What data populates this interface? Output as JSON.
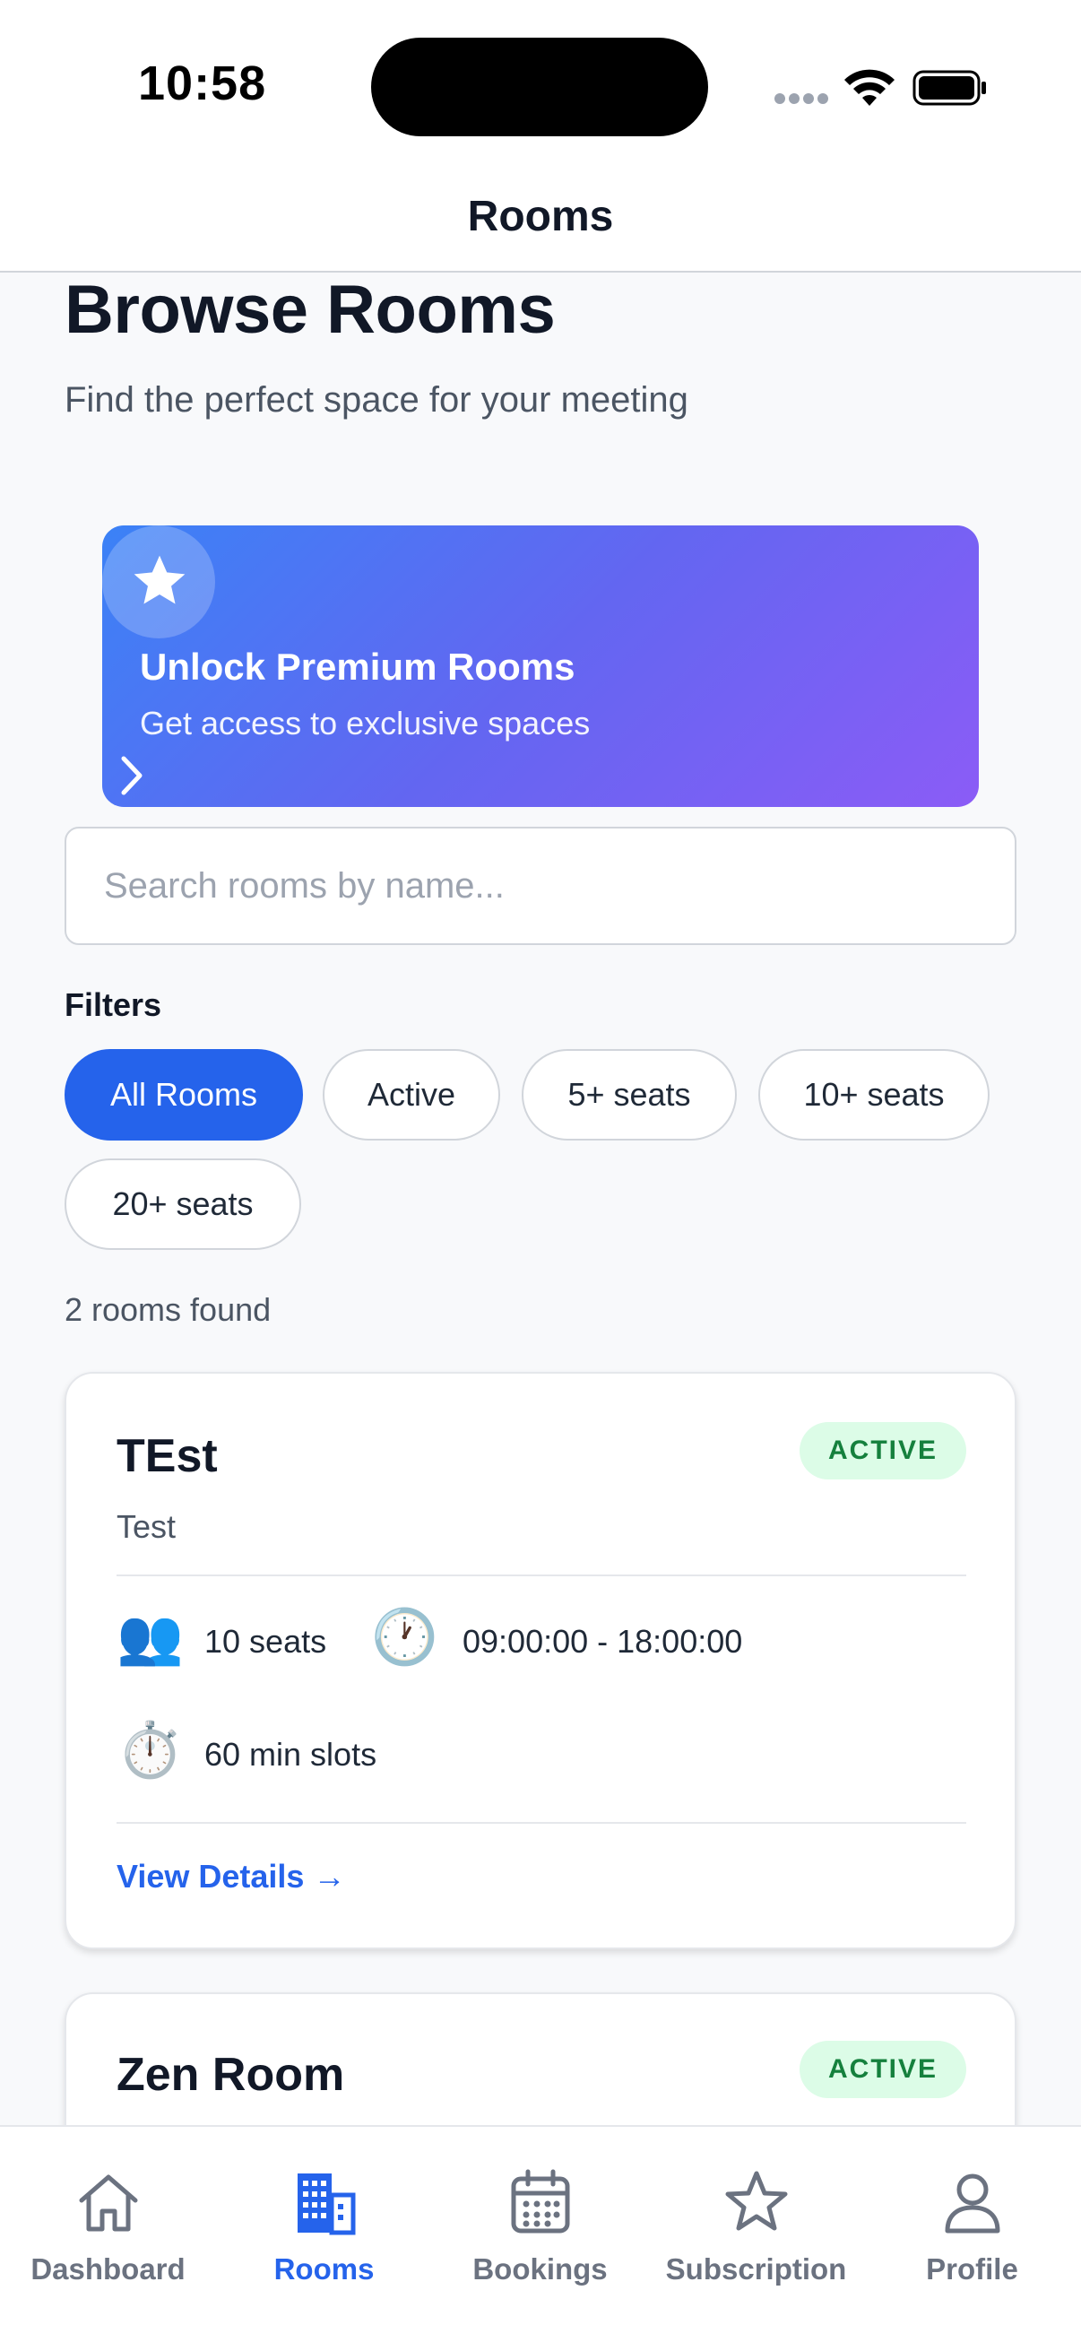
{
  "status_bar": {
    "time": "10:58"
  },
  "nav": {
    "title": "Rooms"
  },
  "header": {
    "title": "Browse Rooms",
    "subtitle": "Find the perfect space for your meeting"
  },
  "premium": {
    "title": "Unlock Premium Rooms",
    "subtitle": "Get access to exclusive spaces",
    "icon": "star-icon"
  },
  "search": {
    "placeholder": "Search rooms by name...",
    "value": ""
  },
  "filters": {
    "label": "Filters",
    "chips": [
      {
        "label": "All Rooms",
        "selected": true
      },
      {
        "label": "Active",
        "selected": false
      },
      {
        "label": "5+ seats",
        "selected": false
      },
      {
        "label": "10+ seats",
        "selected": false
      },
      {
        "label": "20+ seats",
        "selected": false
      }
    ]
  },
  "results": {
    "count_text": "2 rooms found"
  },
  "rooms": [
    {
      "name": "TEst",
      "status": "ACTIVE",
      "description": "Test",
      "seats": "10 seats",
      "hours": "09:00:00 - 18:00:00",
      "slots": "60 min slots",
      "link": "View Details →",
      "seats_icon": "👥",
      "hours_icon": "🕐",
      "slots_icon": "⏱️"
    },
    {
      "name": "Zen Room",
      "status": "ACTIVE"
    }
  ],
  "tabs": [
    {
      "label": "Dashboard",
      "icon": "house-icon"
    },
    {
      "label": "Rooms",
      "icon": "building-icon",
      "active": true
    },
    {
      "label": "Bookings",
      "icon": "calendar-icon"
    },
    {
      "label": "Subscription",
      "icon": "star-icon"
    },
    {
      "label": "Profile",
      "icon": "person-icon"
    }
  ],
  "colors": {
    "accent": "#2563eb",
    "badge_bg": "#dcfce7",
    "badge_text": "#15803d",
    "gradient_start": "#3b82f6",
    "gradient_end": "#8b5cf6"
  }
}
